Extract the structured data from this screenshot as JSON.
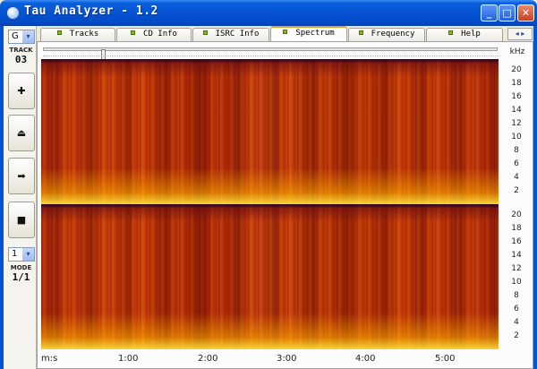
{
  "window": {
    "title": "Tau Analyzer - 1.2",
    "minimize_glyph": "_",
    "maximize_glyph": "□",
    "close_glyph": "✕"
  },
  "sidebar": {
    "drive_value": "G",
    "drive_arrow": "▾",
    "track_label": "TRACK",
    "track_value": "03",
    "buttons": [
      {
        "name": "zoom-in",
        "glyph": "✚"
      },
      {
        "name": "eject",
        "glyph": "⏏"
      },
      {
        "name": "play",
        "glyph": "➡"
      },
      {
        "name": "stop",
        "glyph": "■"
      }
    ],
    "mode_select_value": "1",
    "mode_arrow": "▾",
    "mode_label": "MODE",
    "mode_value": "1/1"
  },
  "tabs": [
    {
      "label": "Tracks"
    },
    {
      "label": "CD Info"
    },
    {
      "label": "ISRC Info"
    },
    {
      "label": "Spectrum",
      "active": true
    },
    {
      "label": "Frequency"
    },
    {
      "label": "Help"
    }
  ],
  "tab_scroll_glyph": "◂ ▸",
  "spectrum": {
    "freq_unit": "kHz",
    "freq_ticks": [
      "20",
      "18",
      "16",
      "14",
      "12",
      "10",
      "8",
      "6",
      "4",
      "2"
    ],
    "time_ticks": [
      "m:s",
      "1:00",
      "2:00",
      "3:00",
      "4:00",
      "5:00"
    ]
  },
  "colors": {
    "titlebar": "#0453d2",
    "spectrum_base": "#b8320c",
    "spectrum_low": "#ffe63c",
    "spectrum_high": "#1e001e"
  }
}
